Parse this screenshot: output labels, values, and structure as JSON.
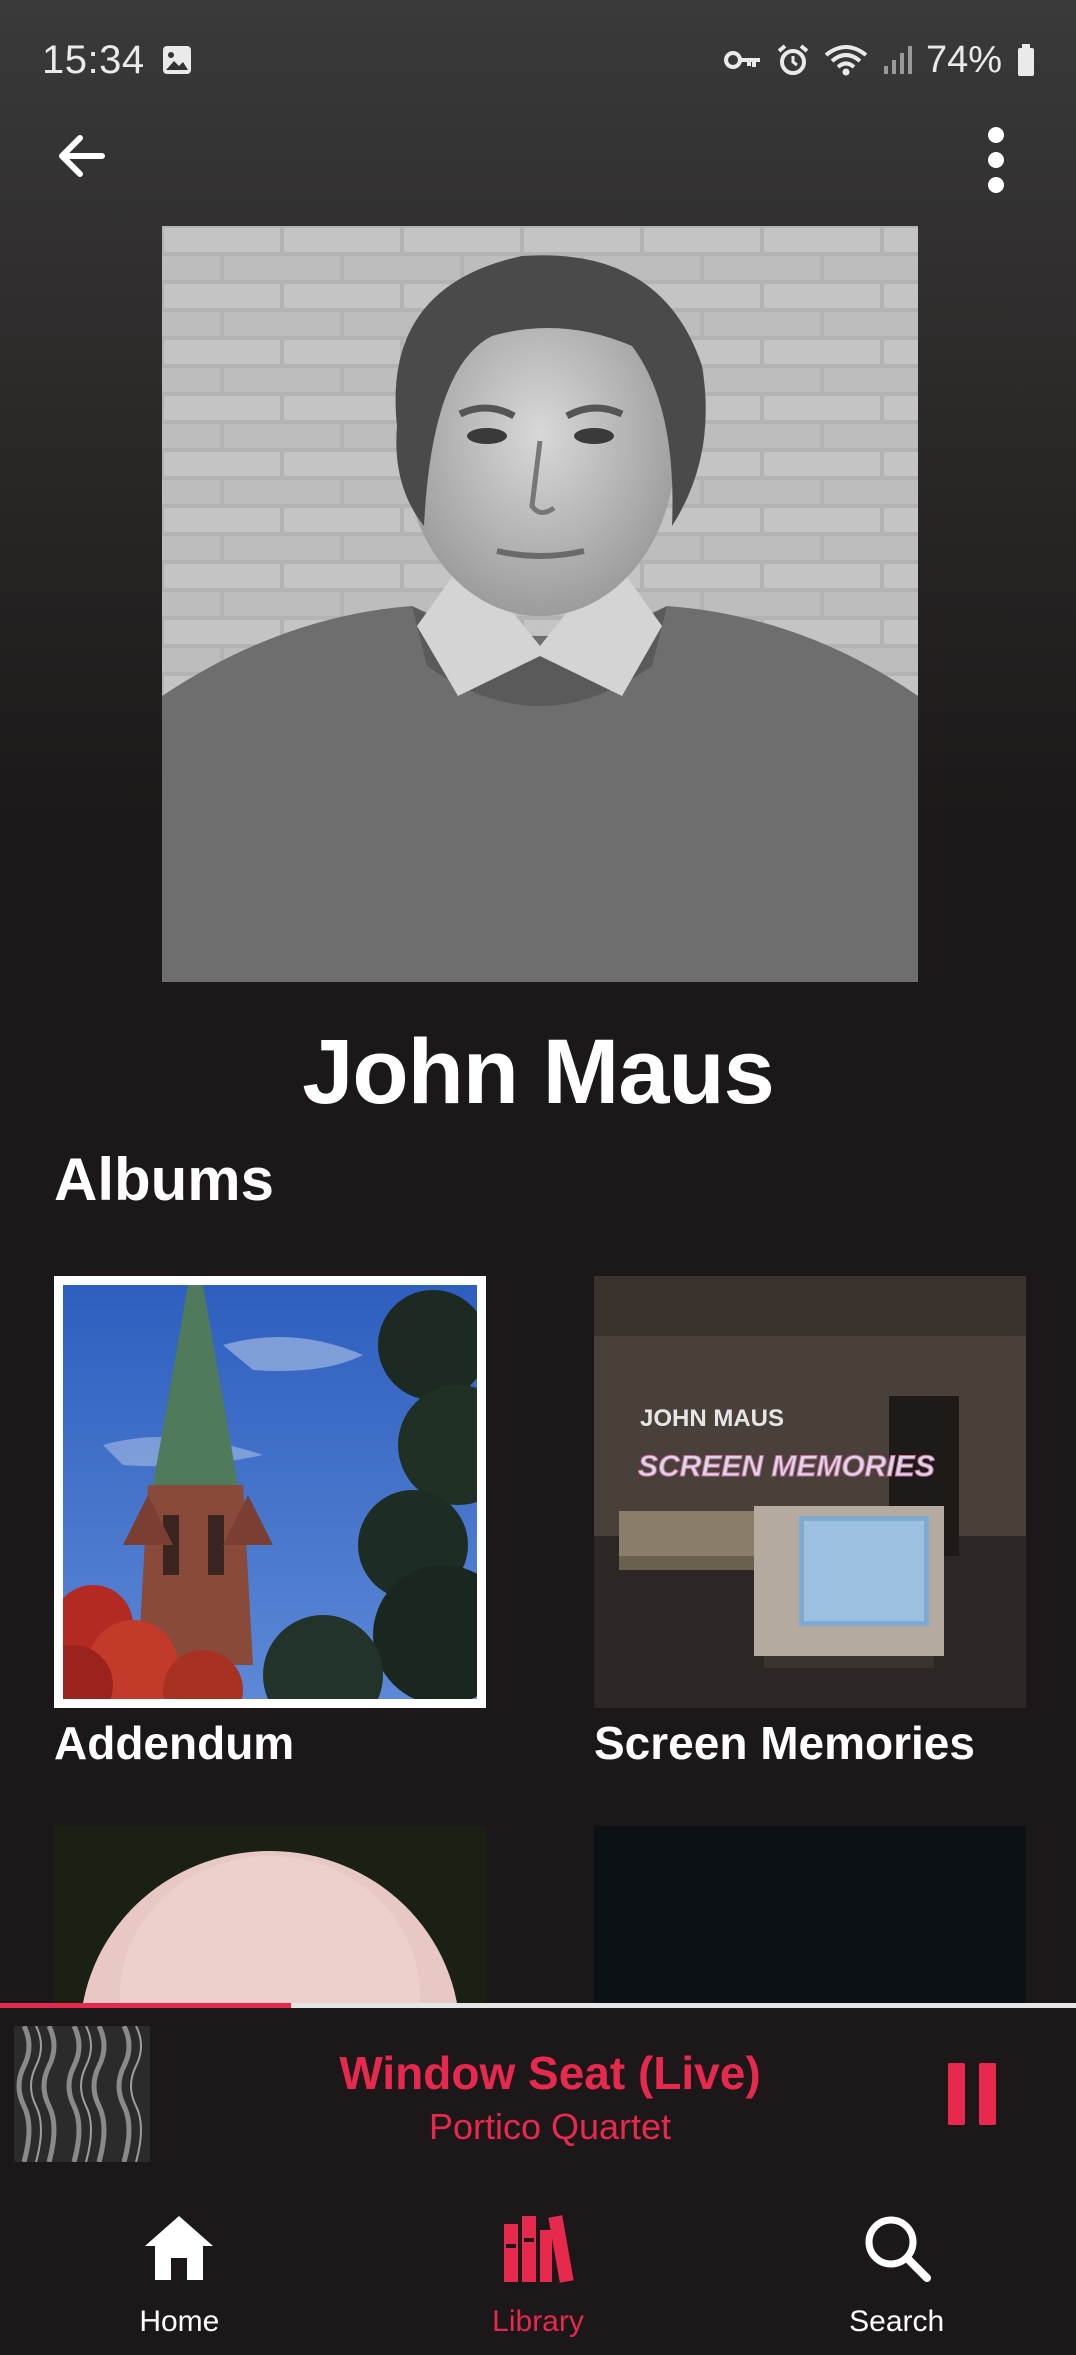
{
  "status_bar": {
    "time": "15:34",
    "battery": "74%",
    "icons": [
      "gallery-icon",
      "key-icon",
      "alarm-icon",
      "wifi-icon",
      "signal-icon",
      "battery-icon"
    ]
  },
  "top_bar": {
    "back_icon": "arrow-left-icon",
    "menu_icon": "more-vertical-icon"
  },
  "artist": {
    "name": "John Maus"
  },
  "albums_section": {
    "title": "Albums",
    "items": [
      {
        "title": "Addendum",
        "selected": true,
        "cover_text": []
      },
      {
        "title": "Screen Memories",
        "selected": false,
        "cover_text": [
          "JOHN MAUS",
          "SCREEN MEMORIES"
        ]
      },
      {
        "title": "",
        "selected": false,
        "cover_text": []
      },
      {
        "title": "",
        "selected": false,
        "cover_text": []
      }
    ]
  },
  "now_playing": {
    "title": "Window Seat (Live)",
    "artist": "Portico Quartet",
    "progress": 0.27,
    "control_icon": "pause-icon"
  },
  "bottom_nav": {
    "items": [
      {
        "label": "Home",
        "icon": "home-icon",
        "active": false
      },
      {
        "label": "Library",
        "icon": "library-icon",
        "active": true
      },
      {
        "label": "Search",
        "icon": "search-icon",
        "active": false
      }
    ]
  },
  "colors": {
    "accent": "#e8294e",
    "background": "#1c1819",
    "text": "#ffffff"
  }
}
